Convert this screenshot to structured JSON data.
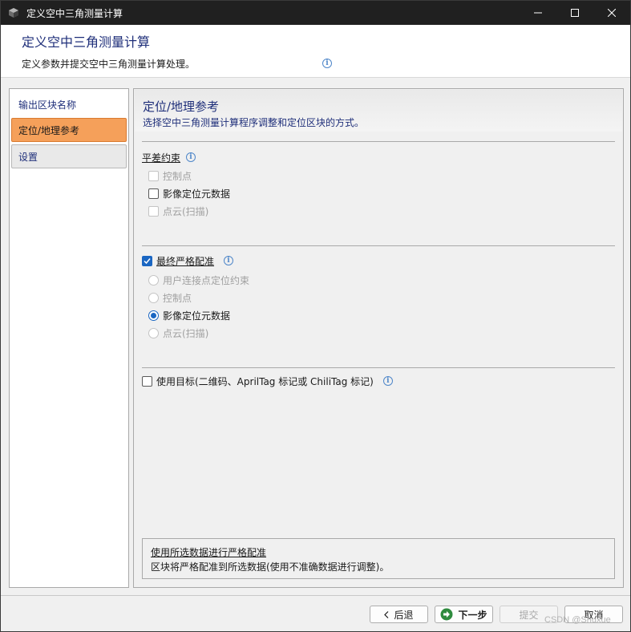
{
  "window": {
    "title": "定义空中三角测量计算"
  },
  "header": {
    "title": "定义空中三角测量计算",
    "description": "定义参数并提交空中三角测量计算处理。",
    "info_icon": "info-icon"
  },
  "nav": {
    "items": [
      {
        "label": "输出区块名称",
        "state": "normal"
      },
      {
        "label": "定位/地理参考",
        "state": "active"
      },
      {
        "label": "设置",
        "state": "normal"
      }
    ]
  },
  "section": {
    "title": "定位/地理参考",
    "description": "选择空中三角测量计算程序调整和定位区块的方式。"
  },
  "adjustment_constraints": {
    "label": "平差约束",
    "options": [
      {
        "label": "控制点",
        "checked": false,
        "enabled": false
      },
      {
        "label": "影像定位元数据",
        "checked": false,
        "enabled": true
      },
      {
        "label": "点云(扫描)",
        "checked": false,
        "enabled": false
      }
    ]
  },
  "final_rigid_registration": {
    "label": "最终严格配准",
    "checked": true,
    "options": [
      {
        "label": "用户连接点定位约束",
        "selected": false,
        "enabled": false
      },
      {
        "label": "控制点",
        "selected": false,
        "enabled": false
      },
      {
        "label": "影像定位元数据",
        "selected": true,
        "enabled": true
      },
      {
        "label": "点云(扫描)",
        "selected": false,
        "enabled": false
      }
    ]
  },
  "targets": {
    "label": "使用目标(二维码、AprilTag 标记或 ChiliTag 标记)",
    "checked": false
  },
  "hint": {
    "title": "使用所选数据进行严格配准",
    "description": "区块将严格配准到所选数据(使用不准确数据进行调整)。"
  },
  "footer": {
    "back_label": "后退",
    "next_label": "下一步",
    "submit_label": "提交",
    "cancel_label": "取消"
  },
  "watermark": "CSDN @Shuxue",
  "colors": {
    "accent": "#1a66c2",
    "nav_active": "#f5a05a",
    "title_text": "#1f2f7a"
  }
}
